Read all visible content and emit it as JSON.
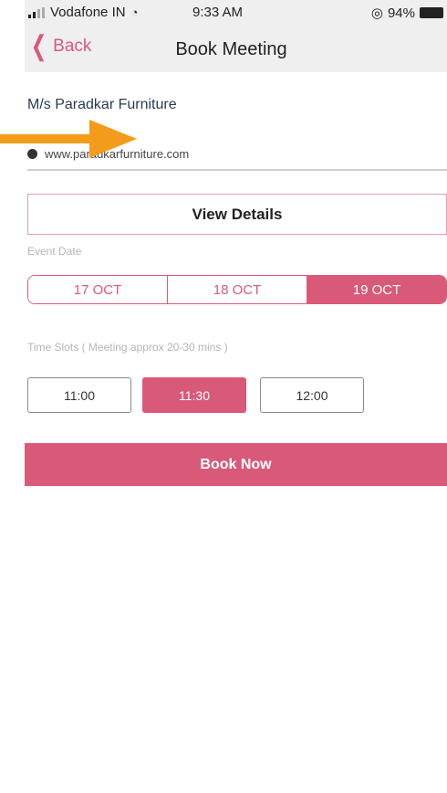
{
  "status_bar": {
    "carrier": "Vodafone IN",
    "time": "9:33 AM",
    "battery": "94%"
  },
  "nav": {
    "back_label": "Back",
    "title": "Book Meeting"
  },
  "company": {
    "name": "M/s Paradkar Furniture",
    "website": "www.paradkarfurniture.com"
  },
  "view_details_label": "View Details",
  "event_date_label": "Event Date",
  "dates": [
    {
      "label": "17 OCT",
      "selected": false
    },
    {
      "label": "18 OCT",
      "selected": false
    },
    {
      "label": "19 OCT",
      "selected": true
    }
  ],
  "time_slots_label": "Time Slots ( Meeting approx 20-30 mins )",
  "slots": [
    {
      "label": "11:00",
      "selected": false
    },
    {
      "label": "11:30",
      "selected": true
    },
    {
      "label": "12:00",
      "selected": false
    }
  ],
  "book_now_label": "Book Now",
  "colors": {
    "accent": "#d95a78",
    "header_bg": "#efefef",
    "annotation_arrow": "#f39c1b"
  },
  "icons": {
    "back": "chevron-left-icon",
    "globe": "globe-icon",
    "wifi": "wifi-icon",
    "battery": "battery-icon"
  }
}
